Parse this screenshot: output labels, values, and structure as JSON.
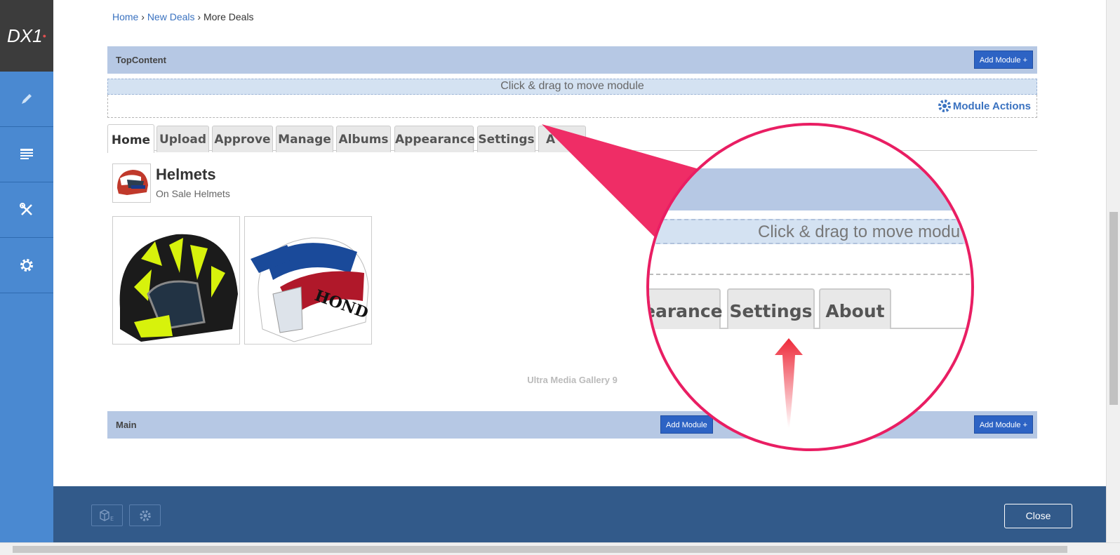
{
  "sidebar": {
    "logo": "DX1"
  },
  "breadcrumb": {
    "home": "Home",
    "sep1": "›",
    "new_deals": "New Deals",
    "sep2": "›",
    "current": "More Deals"
  },
  "top_pane": {
    "title": "TopContent",
    "add_module": "Add Module +"
  },
  "module": {
    "drag_hint": "Click & drag to move module",
    "actions": "Module Actions"
  },
  "tabs": [
    {
      "label": "Home"
    },
    {
      "label": "Upload"
    },
    {
      "label": "Approve"
    },
    {
      "label": "Manage"
    },
    {
      "label": "Albums"
    },
    {
      "label": "Appearance"
    },
    {
      "label": "Settings"
    },
    {
      "label": "A"
    }
  ],
  "gallery": {
    "title": "Helmets",
    "subtitle": "On Sale Helmets",
    "credit": "Ultra Media Gallery 9"
  },
  "main_pane": {
    "title": "Main",
    "add_module": "Add Module +",
    "add_module_partial": "Add Module"
  },
  "magnifier": {
    "drag_hint": "Click & drag to move modu",
    "tab_partial": "earance",
    "tab_settings": "Settings",
    "tab_about": "About"
  },
  "footer": {
    "close": "Close"
  },
  "colors": {
    "accent": "#e91e63",
    "sidebar": "#4a89d1",
    "footer": "#325a8a",
    "pane": "#b6c8e4"
  }
}
